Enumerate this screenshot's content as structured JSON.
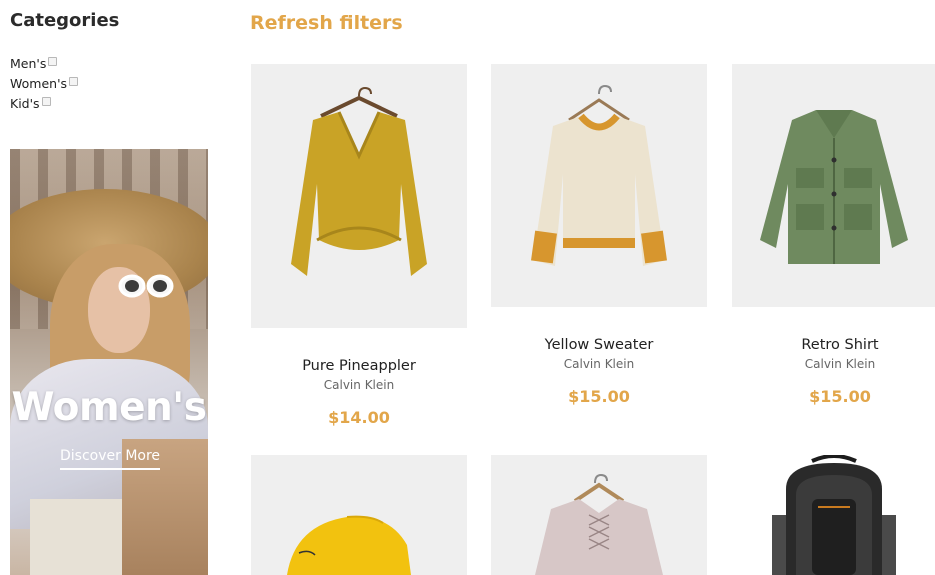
{
  "sidebar": {
    "title": "Categories",
    "categories": [
      {
        "label": "Men's",
        "checked": false
      },
      {
        "label": "Women's",
        "checked": false
      },
      {
        "label": "Kid's",
        "checked": false
      }
    ],
    "banner": {
      "title": "Women's",
      "link": "Discover More"
    }
  },
  "main": {
    "refresh_label": "Refresh filters",
    "accent_color": "#e2a64a",
    "products": [
      {
        "name": "Pure Pineappler",
        "brand": "Calvin Klein",
        "price": "$14.00",
        "image_icon": "mustard-sweater-icon"
      },
      {
        "name": "Yellow Sweater",
        "brand": "Calvin Klein",
        "price": "$15.00",
        "image_icon": "cream-sweater-icon"
      },
      {
        "name": "Retro Shirt",
        "brand": "Calvin Klein",
        "price": "$15.00",
        "image_icon": "green-jacket-icon"
      },
      {
        "image_icon": "yellow-cap-icon"
      },
      {
        "image_icon": "pink-sweater-icon"
      },
      {
        "image_icon": "backpack-icon"
      }
    ]
  }
}
